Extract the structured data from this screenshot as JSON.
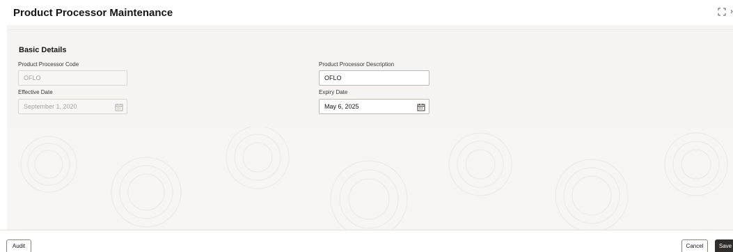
{
  "header": {
    "title": "Product Processor Maintenance",
    "expand_icon": "expand-icon",
    "close_icon": "chevron-right-icon"
  },
  "section": {
    "title": "Basic Details"
  },
  "fields": {
    "code_label": "Product Processor Code",
    "code_value": "OFLO",
    "description_label": "Product Processor Description",
    "description_value": "OFLO",
    "effective_label": "Effective Date",
    "effective_value": "September 1, 2020",
    "expiry_label": "Expiry Date",
    "expiry_value": "May 6, 2025"
  },
  "footer": {
    "audit_label": "Audit",
    "cancel_label": "Cancel",
    "save_label": "Save"
  },
  "colors": {
    "save_button": "#312d2a",
    "panel_bg": "#f5f4f2"
  }
}
